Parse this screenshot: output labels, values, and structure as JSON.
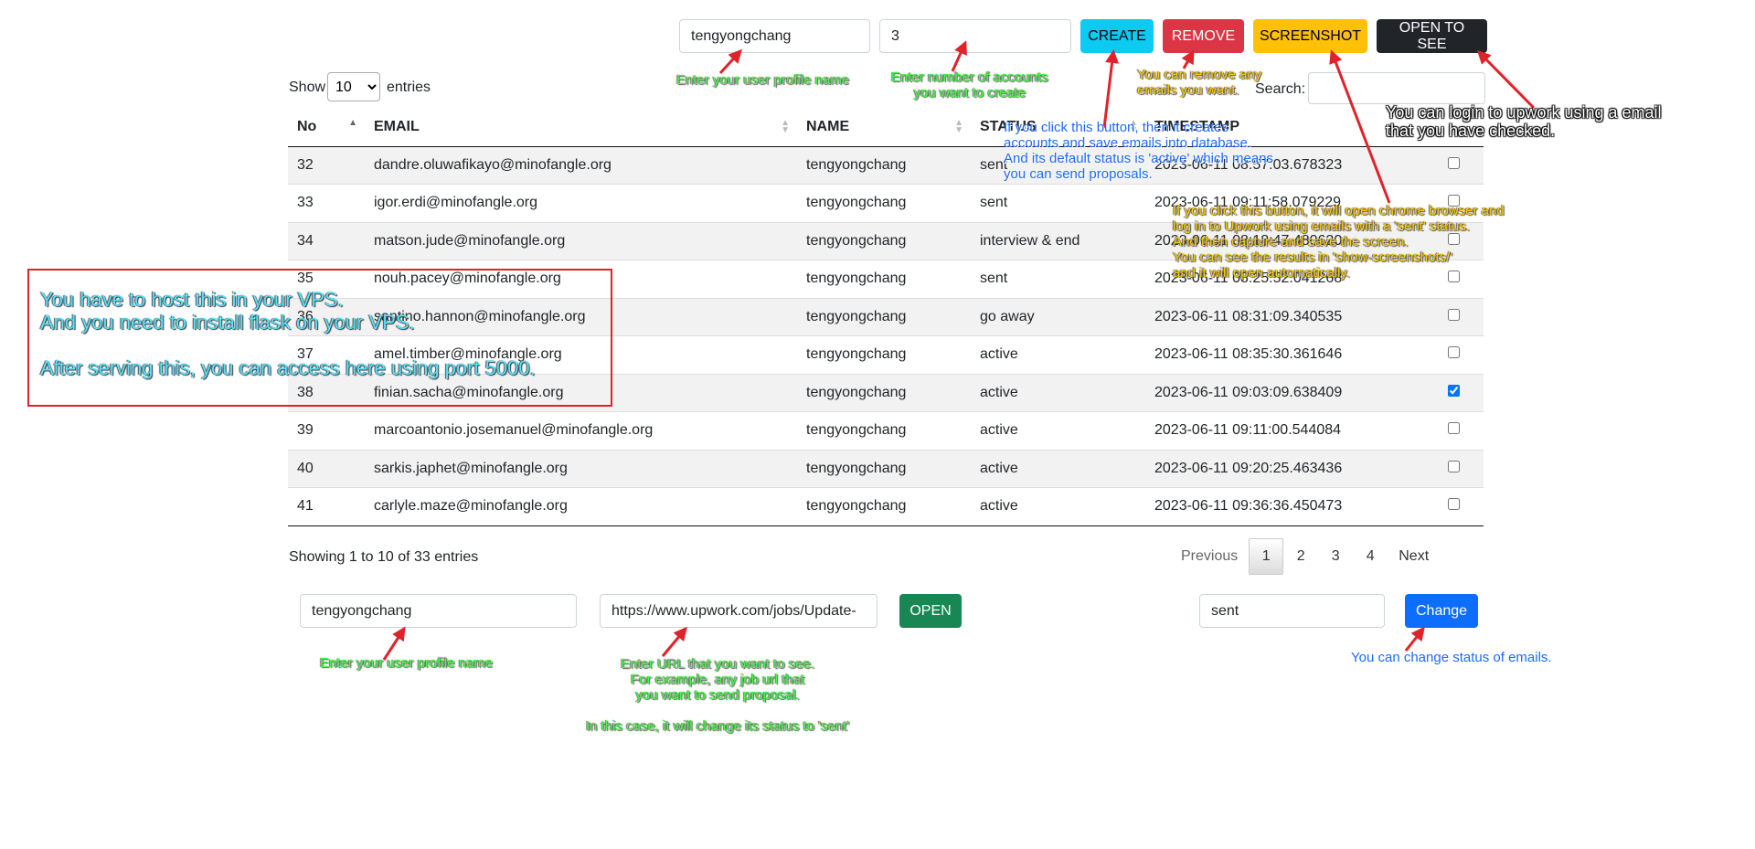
{
  "top_form": {
    "profile_value": "tengyongchang",
    "count_value": "3",
    "create_label": "CREATE",
    "remove_label": "REMOVE",
    "screenshot_label": "SCREENSHOT",
    "open_to_see_label": "OPEN TO SEE"
  },
  "length_menu": {
    "show": "Show",
    "selected": "10",
    "options": [
      "10"
    ],
    "entries": "entries"
  },
  "search": {
    "label": "Search:",
    "value": ""
  },
  "table": {
    "headers": [
      "No",
      "EMAIL",
      "NAME",
      "STATUS",
      "TIMESTAMP"
    ],
    "rows": [
      {
        "no": "32",
        "email": "dandre.oluwafikayo@minofangle.org",
        "name": "tengyongchang",
        "status": "sent",
        "timestamp": "2023-06-11 08:57:03.678323",
        "checked": false
      },
      {
        "no": "33",
        "email": "igor.erdi@minofangle.org",
        "name": "tengyongchang",
        "status": "sent",
        "timestamp": "2023-06-11 09:11:58.079229",
        "checked": false
      },
      {
        "no": "34",
        "email": "matson.jude@minofangle.org",
        "name": "tengyongchang",
        "status": "interview & end",
        "timestamp": "2023-06-11 08:18:47.480620",
        "checked": false
      },
      {
        "no": "35",
        "email": "nouh.pacey@minofangle.org",
        "name": "tengyongchang",
        "status": "sent",
        "timestamp": "2023-06-11 08:25:52.041268",
        "checked": false
      },
      {
        "no": "36",
        "email": "santino.hannon@minofangle.org",
        "name": "tengyongchang",
        "status": "go away",
        "timestamp": "2023-06-11 08:31:09.340535",
        "checked": false
      },
      {
        "no": "37",
        "email": "amel.timber@minofangle.org",
        "name": "tengyongchang",
        "status": "active",
        "timestamp": "2023-06-11 08:35:30.361646",
        "checked": false
      },
      {
        "no": "38",
        "email": "finian.sacha@minofangle.org",
        "name": "tengyongchang",
        "status": "active",
        "timestamp": "2023-06-11 09:03:09.638409",
        "checked": true
      },
      {
        "no": "39",
        "email": "marcoantonio.josemanuel@minofangle.org",
        "name": "tengyongchang",
        "status": "active",
        "timestamp": "2023-06-11 09:11:00.544084",
        "checked": false
      },
      {
        "no": "40",
        "email": "sarkis.japhet@minofangle.org",
        "name": "tengyongchang",
        "status": "active",
        "timestamp": "2023-06-11 09:20:25.463436",
        "checked": false
      },
      {
        "no": "41",
        "email": "carlyle.maze@minofangle.org",
        "name": "tengyongchang",
        "status": "active",
        "timestamp": "2023-06-11 09:36:36.450473",
        "checked": false
      }
    ]
  },
  "info": "Showing 1 to 10 of 33 entries",
  "pagination": {
    "previous": "Previous",
    "pages": [
      "1",
      "2",
      "3",
      "4"
    ],
    "current": "1",
    "next": "Next"
  },
  "bottom_form": {
    "profile_value": "tengyongchang",
    "url_value": "https://www.upwork.com/jobs/Update-",
    "open_label": "OPEN",
    "status_value": "sent",
    "change_label": "Change"
  },
  "annotations": {
    "profile_top": "Enter your user profile name",
    "count": "Enter number of accounts\nyou want to create",
    "remove": "You can remove any\nemails you want.",
    "create": "If you click this button, then it creates\naccounts and save emails into database.\nAnd its default status is 'active' which means\nyou can send proposals.",
    "screenshot": "If you click this button, it will open chrome browser and\nlog in to Upwork using emails with a 'sent' status.\nAnd then capture and save the screen.\nYou can see the results in 'show-screenshots/'\nand it will open automatically.",
    "open_to_see": "You can login to upwork using a email\nthat you have checked.",
    "vps": "You have to host this in your VPS.\nAnd you need to install flask on your VPS.\n\nAfter serving this, you can access here using port 5000.",
    "profile_bottom": "Enter your user profile name",
    "url": "Enter URL that you want to see.\nFor example, any job url that\nyou want to send proposal.\n\nIn this case, it will change its status to 'sent'",
    "change": "You can change status of emails."
  },
  "colors": {
    "create": "#0dcaf0",
    "remove": "#dc3545",
    "screenshot": "#ffc107",
    "open_to_see": "#212529",
    "open": "#198754",
    "change": "#0d6efd",
    "annotation_red": "#e0222a"
  }
}
